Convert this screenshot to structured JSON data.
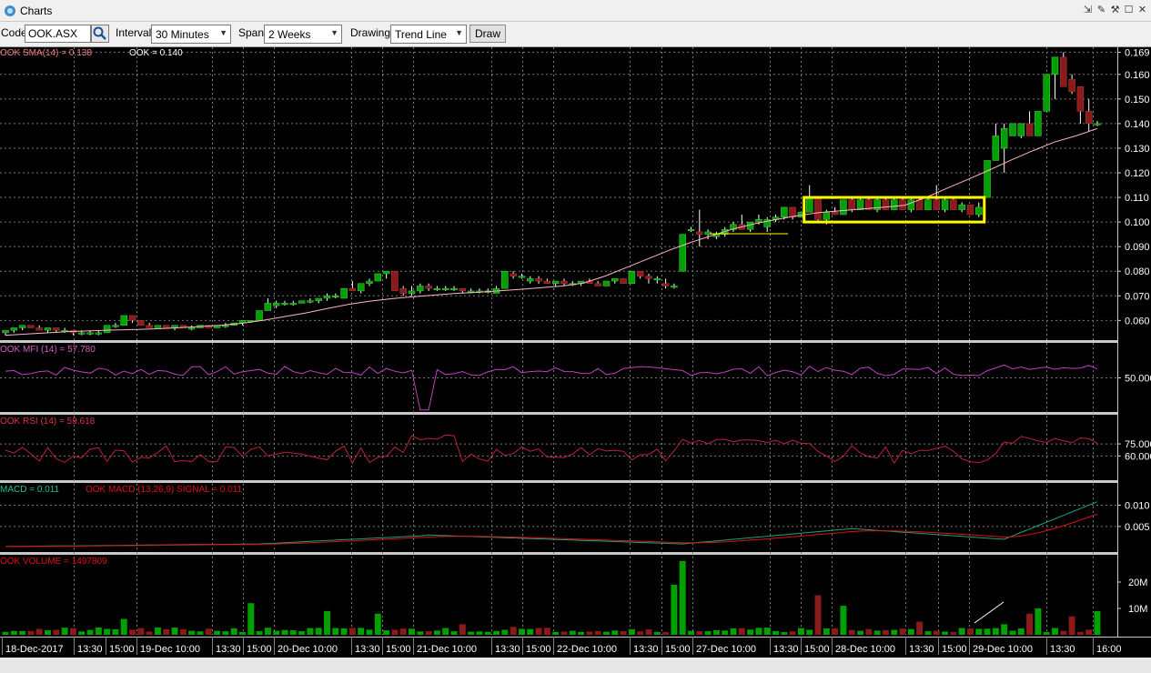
{
  "window": {
    "title": "Charts"
  },
  "toolbar": {
    "code_label": "Code",
    "code_value": "OOK.ASX",
    "interval_label": "Interval",
    "interval_value": "30 Minutes",
    "span_label": "Span",
    "span_value": "2 Weeks",
    "drawing_label": "Drawing",
    "drawing_value": "Trend Line",
    "draw_button": "Draw"
  },
  "colors": {
    "background": "#000000",
    "up_candle": "#00a000",
    "down_candle": "#8b1a1a",
    "sma_line": "#ffb6c1",
    "mfi_line": "#c040c0",
    "rsi_line": "#c0203a",
    "macd_line": "#20a080",
    "signal_line": "#e01010",
    "highlight_box": "#ffff00",
    "grid": "#7a7a7a"
  },
  "chart_data": [
    {
      "type": "candlestick",
      "title": "",
      "legend": [
        "OOK SMA(14) = 0.138",
        "OOK = 0.140"
      ],
      "ylim": [
        0.052,
        0.171
      ],
      "yticks": [
        "0.060",
        "0.070",
        "0.080",
        "0.090",
        "0.100",
        "0.110",
        "0.120",
        "0.130",
        "0.140",
        "0.150",
        "0.160",
        "0.169"
      ],
      "candles": [
        [
          0.055,
          0.056,
          0.054,
          0.056
        ],
        [
          0.056,
          0.057,
          0.055,
          0.057
        ],
        [
          0.057,
          0.058,
          0.056,
          0.058
        ],
        [
          0.058,
          0.058,
          0.057,
          0.057
        ],
        [
          0.057,
          0.058,
          0.056,
          0.056
        ],
        [
          0.056,
          0.057,
          0.055,
          0.057
        ],
        [
          0.057,
          0.057,
          0.055,
          0.056
        ],
        [
          0.056,
          0.057,
          0.055,
          0.056
        ],
        [
          0.056,
          0.056,
          0.054,
          0.055
        ],
        [
          0.055,
          0.056,
          0.054,
          0.055
        ],
        [
          0.055,
          0.056,
          0.054,
          0.055
        ],
        [
          0.055,
          0.056,
          0.054,
          0.055
        ],
        [
          0.055,
          0.058,
          0.055,
          0.058
        ],
        [
          0.058,
          0.059,
          0.057,
          0.058
        ],
        [
          0.058,
          0.062,
          0.058,
          0.062
        ],
        [
          0.062,
          0.062,
          0.059,
          0.06
        ],
        [
          0.06,
          0.06,
          0.058,
          0.058
        ],
        [
          0.058,
          0.059,
          0.057,
          0.057
        ],
        [
          0.057,
          0.058,
          0.057,
          0.058
        ],
        [
          0.058,
          0.058,
          0.057,
          0.057
        ],
        [
          0.057,
          0.058,
          0.056,
          0.058
        ],
        [
          0.058,
          0.058,
          0.057,
          0.057
        ],
        [
          0.057,
          0.058,
          0.056,
          0.057
        ],
        [
          0.057,
          0.058,
          0.057,
          0.058
        ],
        [
          0.058,
          0.058,
          0.057,
          0.057
        ],
        [
          0.057,
          0.058,
          0.057,
          0.058
        ],
        [
          0.058,
          0.059,
          0.057,
          0.058
        ],
        [
          0.058,
          0.059,
          0.058,
          0.059
        ],
        [
          0.059,
          0.06,
          0.058,
          0.06
        ],
        [
          0.06,
          0.06,
          0.059,
          0.06
        ],
        [
          0.06,
          0.064,
          0.06,
          0.064
        ],
        [
          0.064,
          0.069,
          0.064,
          0.067
        ],
        [
          0.066,
          0.068,
          0.065,
          0.067
        ],
        [
          0.067,
          0.068,
          0.066,
          0.067
        ],
        [
          0.067,
          0.068,
          0.066,
          0.067
        ],
        [
          0.067,
          0.068,
          0.067,
          0.068
        ],
        [
          0.068,
          0.069,
          0.067,
          0.068
        ],
        [
          0.068,
          0.069,
          0.067,
          0.069
        ],
        [
          0.069,
          0.071,
          0.068,
          0.07
        ],
        [
          0.07,
          0.071,
          0.069,
          0.07
        ],
        [
          0.069,
          0.073,
          0.069,
          0.073
        ],
        [
          0.073,
          0.076,
          0.072,
          0.072
        ],
        [
          0.072,
          0.075,
          0.071,
          0.075
        ],
        [
          0.075,
          0.077,
          0.074,
          0.076
        ],
        [
          0.076,
          0.079,
          0.076,
          0.079
        ],
        [
          0.079,
          0.08,
          0.077,
          0.08
        ],
        [
          0.08,
          0.08,
          0.072,
          0.072
        ],
        [
          0.073,
          0.074,
          0.07,
          0.071
        ],
        [
          0.071,
          0.074,
          0.07,
          0.072
        ],
        [
          0.072,
          0.075,
          0.071,
          0.074
        ],
        [
          0.074,
          0.075,
          0.072,
          0.073
        ],
        [
          0.073,
          0.074,
          0.072,
          0.073
        ],
        [
          0.073,
          0.074,
          0.072,
          0.073
        ],
        [
          0.073,
          0.074,
          0.072,
          0.073
        ],
        [
          0.073,
          0.073,
          0.071,
          0.072
        ],
        [
          0.072,
          0.073,
          0.071,
          0.072
        ],
        [
          0.072,
          0.073,
          0.071,
          0.072
        ],
        [
          0.072,
          0.073,
          0.071,
          0.072
        ],
        [
          0.071,
          0.074,
          0.071,
          0.073
        ],
        [
          0.073,
          0.08,
          0.073,
          0.08
        ],
        [
          0.079,
          0.08,
          0.077,
          0.078
        ],
        [
          0.078,
          0.079,
          0.077,
          0.078
        ],
        [
          0.076,
          0.078,
          0.075,
          0.077
        ],
        [
          0.077,
          0.078,
          0.075,
          0.076
        ],
        [
          0.076,
          0.077,
          0.075,
          0.075
        ],
        [
          0.075,
          0.076,
          0.074,
          0.076
        ],
        [
          0.076,
          0.077,
          0.074,
          0.075
        ],
        [
          0.075,
          0.076,
          0.074,
          0.075
        ],
        [
          0.075,
          0.076,
          0.074,
          0.076
        ],
        [
          0.076,
          0.077,
          0.075,
          0.075
        ],
        [
          0.075,
          0.076,
          0.074,
          0.074
        ],
        [
          0.074,
          0.076,
          0.074,
          0.076
        ],
        [
          0.076,
          0.077,
          0.075,
          0.077
        ],
        [
          0.077,
          0.077,
          0.075,
          0.075
        ],
        [
          0.075,
          0.08,
          0.075,
          0.08
        ],
        [
          0.08,
          0.08,
          0.077,
          0.078
        ],
        [
          0.078,
          0.079,
          0.075,
          0.077
        ],
        [
          0.077,
          0.078,
          0.075,
          0.077
        ],
        [
          0.075,
          0.077,
          0.073,
          0.074
        ],
        [
          0.074,
          0.075,
          0.073,
          0.074
        ],
        [
          0.08,
          0.095,
          0.08,
          0.095
        ],
        [
          0.097,
          0.098,
          0.096,
          0.097
        ],
        [
          0.096,
          0.105,
          0.09,
          0.095
        ],
        [
          0.095,
          0.097,
          0.093,
          0.096
        ],
        [
          0.094,
          0.096,
          0.093,
          0.095
        ],
        [
          0.095,
          0.098,
          0.094,
          0.097
        ],
        [
          0.097,
          0.1,
          0.096,
          0.099
        ],
        [
          0.099,
          0.103,
          0.097,
          0.097
        ],
        [
          0.097,
          0.1,
          0.096,
          0.1
        ],
        [
          0.1,
          0.103,
          0.099,
          0.101
        ],
        [
          0.098,
          0.102,
          0.096,
          0.101
        ],
        [
          0.101,
          0.103,
          0.1,
          0.102
        ],
        [
          0.102,
          0.106,
          0.101,
          0.106
        ],
        [
          0.106,
          0.106,
          0.101,
          0.102
        ],
        [
          0.102,
          0.104,
          0.102,
          0.104
        ],
        [
          0.104,
          0.115,
          0.104,
          0.11
        ],
        [
          0.11,
          0.11,
          0.1,
          0.101
        ],
        [
          0.101,
          0.105,
          0.099,
          0.104
        ],
        [
          0.104,
          0.106,
          0.103,
          0.103
        ],
        [
          0.103,
          0.109,
          0.103,
          0.109
        ],
        [
          0.109,
          0.11,
          0.104,
          0.105
        ],
        [
          0.105,
          0.11,
          0.105,
          0.109
        ],
        [
          0.109,
          0.11,
          0.105,
          0.105
        ],
        [
          0.105,
          0.11,
          0.104,
          0.109
        ],
        [
          0.109,
          0.11,
          0.105,
          0.105
        ],
        [
          0.105,
          0.11,
          0.105,
          0.109
        ],
        [
          0.109,
          0.11,
          0.105,
          0.105
        ],
        [
          0.105,
          0.11,
          0.104,
          0.109
        ],
        [
          0.109,
          0.11,
          0.105,
          0.105
        ],
        [
          0.105,
          0.11,
          0.105,
          0.109
        ],
        [
          0.109,
          0.115,
          0.105,
          0.105
        ],
        [
          0.105,
          0.11,
          0.104,
          0.109
        ],
        [
          0.109,
          0.11,
          0.105,
          0.105
        ],
        [
          0.105,
          0.108,
          0.104,
          0.107
        ],
        [
          0.107,
          0.107,
          0.103,
          0.103
        ],
        [
          0.103,
          0.108,
          0.102,
          0.106
        ],
        [
          0.11,
          0.125,
          0.11,
          0.125
        ],
        [
          0.125,
          0.14,
          0.125,
          0.135
        ],
        [
          0.13,
          0.14,
          0.12,
          0.138
        ],
        [
          0.135,
          0.14,
          0.135,
          0.14
        ],
        [
          0.135,
          0.14,
          0.134,
          0.14
        ],
        [
          0.14,
          0.145,
          0.135,
          0.135
        ],
        [
          0.135,
          0.145,
          0.135,
          0.145
        ],
        [
          0.145,
          0.16,
          0.145,
          0.16
        ],
        [
          0.16,
          0.165,
          0.15,
          0.167
        ],
        [
          0.167,
          0.169,
          0.158,
          0.155
        ],
        [
          0.158,
          0.16,
          0.152,
          0.153
        ],
        [
          0.155,
          0.155,
          0.14,
          0.145
        ],
        [
          0.145,
          0.15,
          0.137,
          0.14
        ],
        [
          0.14,
          0.141,
          0.139,
          0.14
        ]
      ],
      "sma": [
        0.054,
        0.0545,
        0.055,
        0.0555,
        0.0558,
        0.0561,
        0.0563,
        0.0566,
        0.057,
        0.0575,
        0.058,
        0.0588,
        0.06,
        0.0615,
        0.063,
        0.0648,
        0.0665,
        0.0678,
        0.0688,
        0.0696,
        0.0703,
        0.071,
        0.0714,
        0.072,
        0.0726,
        0.0733,
        0.074,
        0.0752,
        0.078,
        0.0815,
        0.085,
        0.0885,
        0.0917,
        0.0945,
        0.0972,
        0.0993,
        0.101,
        0.1026,
        0.1038,
        0.1046,
        0.1053,
        0.106,
        0.1068,
        0.11,
        0.1138,
        0.1175,
        0.1213,
        0.1253,
        0.129,
        0.1325,
        0.135,
        0.138
      ],
      "highlight_box_price_range": [
        0.1,
        0.11
      ]
    },
    {
      "type": "line",
      "legend": "OOK MFI (14) = 57.780",
      "yticks": [
        "50.000"
      ],
      "ylim": [
        0,
        100
      ]
    },
    {
      "type": "line",
      "legend": "OOK RSI (14) = 59.618",
      "yticks": [
        "75.000",
        "60.000"
      ],
      "ylim": [
        30,
        110
      ]
    },
    {
      "type": "line",
      "legend": [
        "MACD = 0.011",
        "OOK MACD (13,26,9) SIGNAL = 0.011"
      ],
      "yticks": [
        "0.010",
        "0.005"
      ],
      "ylim": [
        -0.001,
        0.015
      ]
    },
    {
      "type": "bar",
      "legend": "OOK VOLUME = 1497809",
      "yticks": [
        "20M",
        "10M"
      ],
      "ylim": [
        0,
        30
      ]
    }
  ],
  "xaxis_labels": [
    "18-Dec-2017",
    "13:30",
    "15:00",
    "19-Dec 10:00",
    "13:30",
    "15:00",
    "20-Dec 10:00",
    "13:30",
    "15:00",
    "21-Dec 10:00",
    "13:30",
    "15:00",
    "22-Dec 10:00",
    "13:30",
    "15:00",
    "27-Dec 10:00",
    "13:30",
    "15:00",
    "28-Dec 10:00",
    "13:30",
    "15:00",
    "29-Dec 10:00",
    "13:30",
    "16:00"
  ]
}
